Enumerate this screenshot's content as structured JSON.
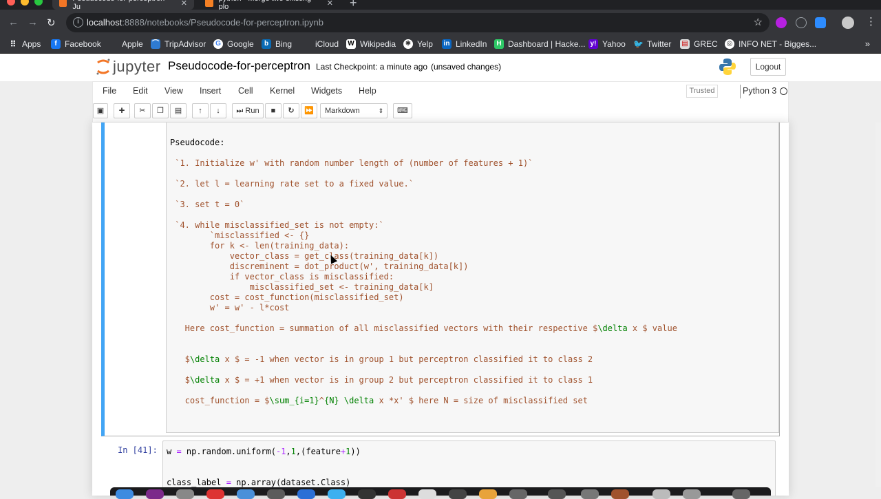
{
  "browser": {
    "tabs": [
      {
        "label": "Pseudocode-for-perceptron - Ju",
        "active": true
      },
      {
        "label": "python - Merge two existing plo",
        "active": false
      }
    ],
    "url_host": "localhost",
    "url_path": ":8888/notebooks/Pseudocode-for-perceptron.ipynb",
    "bookmarks": [
      "Apps",
      "Facebook",
      "Apple",
      "TripAdvisor",
      "Google",
      "Bing",
      "iCloud",
      "Wikipedia",
      "Yelp",
      "LinkedIn",
      "Dashboard | Hacke...",
      "Yahoo",
      "Twitter",
      "GREC",
      "INFO NET - Bigges..."
    ],
    "more_label": "»"
  },
  "jupyter": {
    "logo_text": "jupyter",
    "notebook_name": "Pseudocode-for-perceptron",
    "checkpoint": "Last Checkpoint: a minute ago",
    "unsaved": "(unsaved changes)",
    "logout": "Logout",
    "menus": [
      "File",
      "Edit",
      "View",
      "Insert",
      "Cell",
      "Kernel",
      "Widgets",
      "Help"
    ],
    "trusted": "Trusted",
    "kernel": "Python 3",
    "run_label": "Run",
    "cell_type": "Markdown"
  },
  "markdown_cell": {
    "lines": [
      {
        "text": "Pseudocode:",
        "plain": true
      },
      {
        "text": " `1. Initialize w' with random number length of (number of features + 1)`"
      },
      {
        "text": " `2. let l = learning rate set to a fixed value.`"
      },
      {
        "text": " `3. set t = 0`"
      },
      {
        "text": " `4. while misclassified_set is not empty:`"
      },
      {
        "text": "        `misclassified <- {}"
      },
      {
        "text": "        for k <- len(training_data):"
      },
      {
        "text": "            vector_class = get_class(training_data[k])"
      },
      {
        "text": "            discreminent = dot_product(w', training_data[k])"
      },
      {
        "text": "            if vector_class is misclassified:"
      },
      {
        "text": "                misclassified_set <- training_data[k]"
      },
      {
        "text": "        cost = cost_function(misclassified_set)"
      },
      {
        "text": "        w' = w' - l*cost"
      },
      {
        "text": "   Here cost_function = summation of all misclassified vectors with their respective $"
      },
      {
        "text": "   $"
      },
      {
        "text": "   $"
      },
      {
        "text": "   cost_function = $"
      }
    ],
    "delta_tex": "\\delta",
    "delta_tail_1": " x $ value",
    "line_eq1_tail": " x $ = -1 when vector is in group 1 but perceptron classified it to class 2",
    "line_eq2_tail": " x $ = +1 when vector is in group 2 but perceptron classified it to class 1",
    "sum_tex": "\\sum_",
    "sum_sub": "{i=1}",
    "sum_caret": "^",
    "sum_sup": "{N}",
    "sum_tail_pre": " ",
    "sum_tail": " x *x' $ here N = size of misclassified set"
  },
  "code_cell": {
    "prompt": "In [41]:",
    "line1_a": "w ",
    "line1_eq": "=",
    "line1_b": " np.random.uniform(",
    "line1_n1": "-1",
    "line1_c": ",",
    "line1_n2": "1",
    "line1_d": ",(feature",
    "line1_op": "+",
    "line1_n3": "1",
    "line1_e": "))",
    "line2_a": "class_label ",
    "line2_eq": "=",
    "line2_b": " np.array(dataset.Class)"
  },
  "colors": {
    "accent_selected": "#42a5f5",
    "markdown_text": "#a0522d",
    "prompt": "#303f9f"
  }
}
